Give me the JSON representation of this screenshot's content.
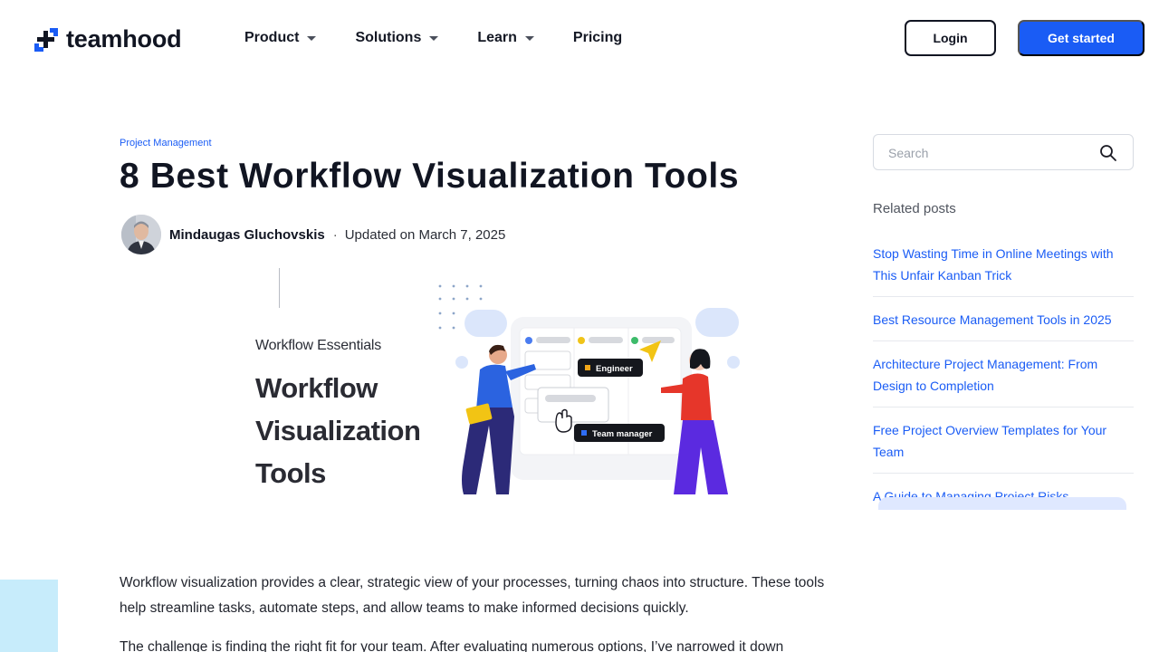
{
  "header": {
    "logo_text": "teamhood",
    "nav": [
      {
        "label": "Product",
        "has_dropdown": true
      },
      {
        "label": "Solutions",
        "has_dropdown": true
      },
      {
        "label": "Learn",
        "has_dropdown": true
      },
      {
        "label": "Pricing",
        "has_dropdown": false
      }
    ],
    "login_label": "Login",
    "get_started_label": "Get started"
  },
  "article": {
    "category": "Project Management",
    "title": "8 Best Workflow Visualization Tools",
    "author": "Mindaugas Gluchovskis",
    "separator": "·",
    "updated": "Updated on March 7, 2025",
    "hero": {
      "kicker": "Workflow Essentials",
      "title_lines": [
        "Workflow",
        "Visualization",
        "Tools"
      ],
      "tag_engineer": "Engineer",
      "tag_manager": "Team manager"
    },
    "paragraphs": [
      "Workflow visualization provides a clear, strategic view of your processes, turning chaos into structure. These tools help streamline tasks, automate steps, and allow teams to make informed decisions quickly.",
      "The challenge is finding the right fit for your team. After evaluating numerous options, I’ve narrowed it down"
    ]
  },
  "sidebar": {
    "search_placeholder": "Search",
    "related_heading": "Related posts",
    "related_posts": [
      "Stop Wasting Time in Online Meetings with This Unfair Kanban Trick",
      "Best Resource Management Tools in 2025",
      "Architecture Project Management: From Design to Completion",
      "Free Project Overview Templates for Your Team",
      "A Guide to Managing Project Risks"
    ]
  },
  "colors": {
    "accent": "#1a5cf5",
    "text": "#111522",
    "side_square": "#c7ecfb"
  },
  "icons": {
    "logo": "teamhood-plus-logo-icon",
    "caret": "caret-down-icon",
    "search": "search-icon"
  }
}
